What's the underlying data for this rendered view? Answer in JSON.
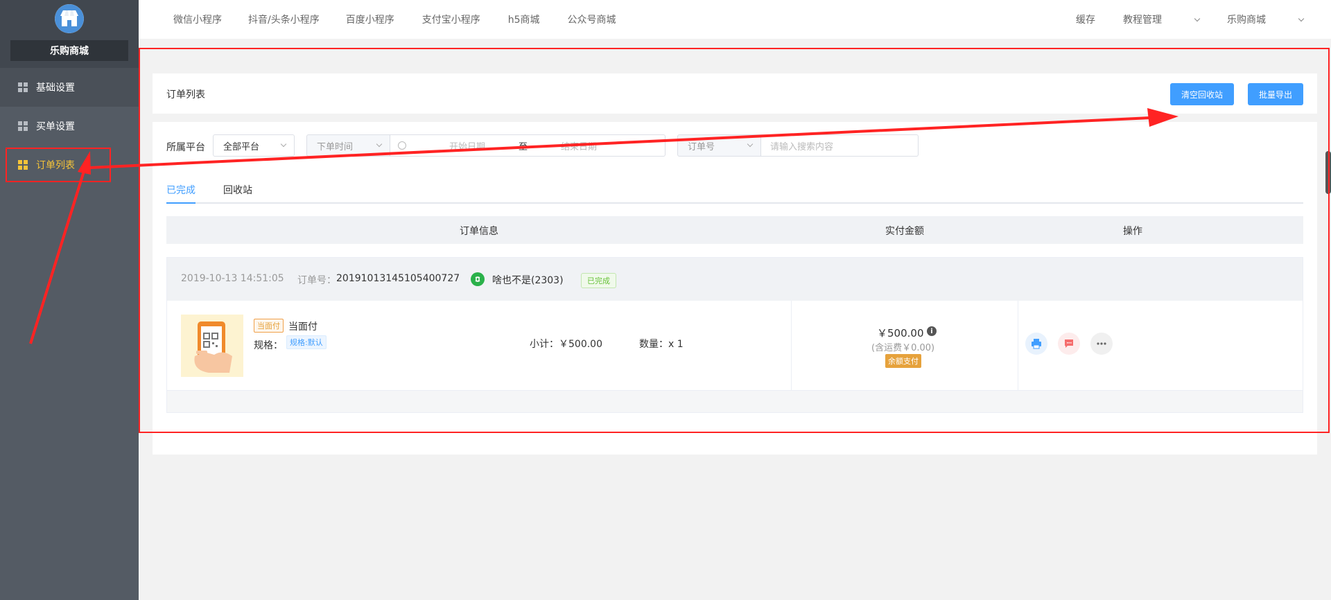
{
  "sidebar": {
    "store_name": "乐购商城",
    "items": [
      {
        "label": "基础设置"
      },
      {
        "label": "买单设置"
      },
      {
        "label": "订单列表"
      }
    ]
  },
  "topnav": {
    "links": [
      "微信小程序",
      "抖音/头条小程序",
      "百度小程序",
      "支付宝小程序",
      "h5商城",
      "公众号商城"
    ],
    "right": {
      "cache": "缓存",
      "tutorial": "教程管理",
      "store": "乐购商城"
    }
  },
  "panel": {
    "title": "订单列表",
    "clear_button": "清空回收站",
    "export_button": "批量导出"
  },
  "filters": {
    "platform_label": "所属平台",
    "platform_value": "全部平台",
    "time_type": "下单时间",
    "start_placeholder": "开始日期",
    "to_label": "至",
    "end_placeholder": "结束日期",
    "keyword_type": "订单号",
    "search_placeholder": "请输入搜索内容"
  },
  "tabs": [
    "已完成",
    "回收站"
  ],
  "table": {
    "headers": [
      "订单信息",
      "实付金额",
      "操作"
    ]
  },
  "order": {
    "time": "2019-10-13 14:51:05",
    "order_no_label": "订单号：",
    "order_no": "20191013145105400727",
    "user": "啥也不是(2303)",
    "status": "已完成",
    "type_tag": "当面付",
    "name": "当面付",
    "spec_label": "规格：",
    "spec_tag": "规格:默认",
    "subtotal": "小计：￥500.00",
    "quantity": "数量：x 1",
    "amount": "￥500.00",
    "shipping": "(含运费￥0.00)",
    "pay_type": "余额支付"
  },
  "colors": {
    "accent": "#409eff",
    "sidebar": "#545b64",
    "active_menu": "#f5c339",
    "annotation": "#ff2323"
  }
}
